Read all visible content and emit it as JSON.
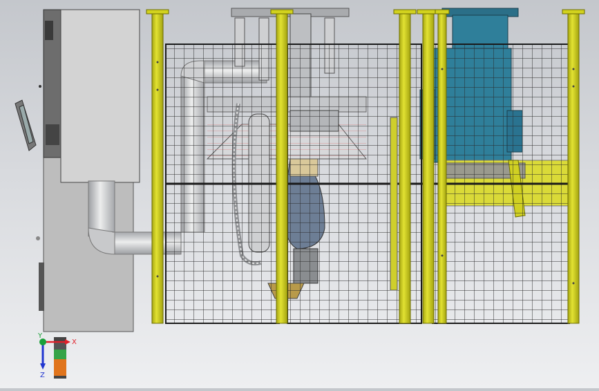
{
  "triad": {
    "x_label": "X",
    "y_label": "Y",
    "z_label": "Z"
  },
  "colors": {
    "fence_post": "#d2d21e",
    "fence_post_edge": "#6b6b00",
    "mesh": "#1e1e1e",
    "cabinet": "#c3c3c3",
    "motor_box": "#2f7f9a",
    "axis_x": "#e0202a",
    "axis_y": "#1aa03a",
    "axis_z": "#2035d0"
  }
}
